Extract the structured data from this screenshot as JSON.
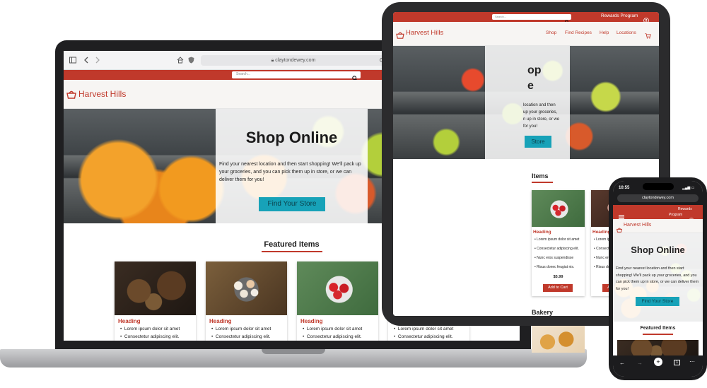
{
  "site": {
    "brand": "Harvest Hills",
    "search_placeholder": "Search...",
    "rewards": "Rewards Program",
    "rewards_line1": "Rewards",
    "rewards_line2": "Program",
    "nav": [
      "Shop",
      "Find Recipes",
      "Help",
      "Locations"
    ],
    "hero_title": "Shop Online",
    "hero_text": "Find your nearest location and then start shopping! We'll pack up your groceries, and you can pick them up in store, or we can deliver them for you!",
    "hero_button": "Find Your Store",
    "featured_title": "Featured Items",
    "card_heading": "Heading",
    "card_bullets": [
      "Lorem ipsum dolor sit amet",
      "Consectetur adipiscing elit."
    ],
    "ipad_bullets": [
      "Lorem ipsum dolor sit amet",
      "Consectetur adipiscing elit.",
      "Nunc eros suspendisse",
      "Risus donec feugiat nis."
    ],
    "price": "$5.99",
    "add_to_cart": "Add to Cart",
    "bakery_title": "Bakery",
    "ipad_featured_fragment": "Items",
    "ipad_hero_fragment": "op",
    "ipad_cta_fragment": "Store",
    "ipad_hero_lines": [
      "location and then",
      "up your groceries,",
      "n up in store, or we",
      "for you!"
    ]
  },
  "browser": {
    "url": "claytondewey.com",
    "phone_url": "claytondewey.com",
    "phone_time": "10:55"
  }
}
